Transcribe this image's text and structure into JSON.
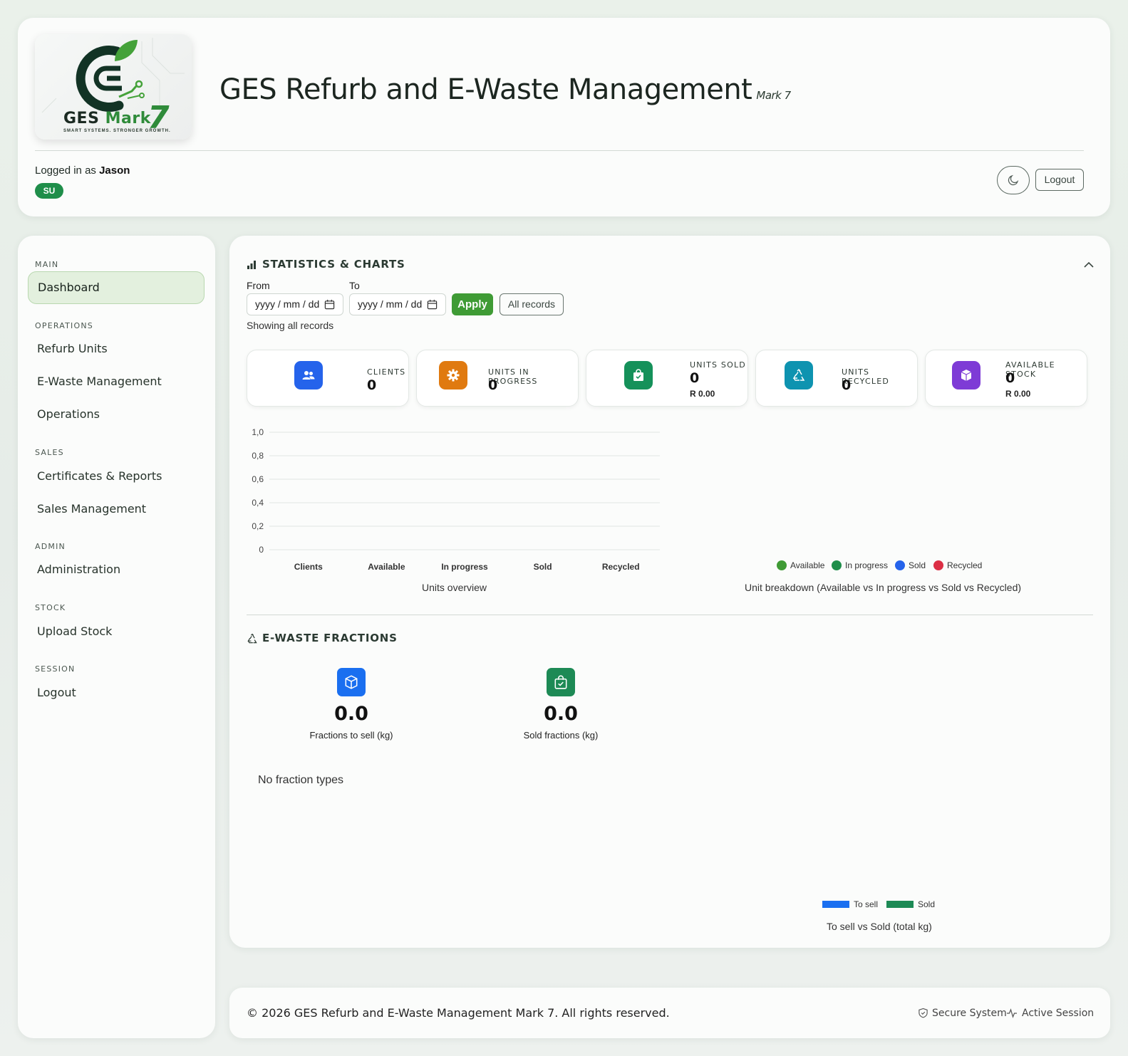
{
  "header": {
    "logo_brand_word": "GES",
    "logo_brand_word2": "Mark",
    "logo_brand_num": "7",
    "logo_tagline": "SMART SYSTEMS. STRONGER GROWTH.",
    "app_title": "GES Refurb and E-Waste Management",
    "app_version": "Mark 7",
    "logged_in_prefix": "Logged in as",
    "username": "Jason",
    "role_badge": "SU",
    "theme_toggle_icon": "moon-icon",
    "logout_label": "Logout"
  },
  "sidebar": {
    "sections": [
      {
        "label": "MAIN",
        "items": [
          {
            "label": "Dashboard",
            "active": true
          }
        ]
      },
      {
        "label": "OPERATIONS",
        "items": [
          {
            "label": "Refurb Units"
          },
          {
            "label": "E-Waste Management"
          },
          {
            "label": "Operations"
          }
        ]
      },
      {
        "label": "SALES",
        "items": [
          {
            "label": "Certificates & Reports"
          },
          {
            "label": "Sales Management"
          }
        ]
      },
      {
        "label": "ADMIN",
        "items": [
          {
            "label": "Administration"
          }
        ]
      },
      {
        "label": "STOCK",
        "items": [
          {
            "label": "Upload Stock"
          }
        ]
      },
      {
        "label": "SESSION",
        "items": [
          {
            "label": "Logout"
          }
        ]
      }
    ]
  },
  "stats": {
    "title": "STATISTICS & CHARTS",
    "from_label": "From",
    "to_label": "To",
    "from_placeholder": "yyyy / mm / dd",
    "to_placeholder": "yyyy / mm / dd",
    "apply_label": "Apply",
    "all_records_label": "All records",
    "showing_text": "Showing all records",
    "cards": [
      {
        "label": "CLIENTS",
        "value": "0",
        "color": "#2563eb",
        "icon": "users-icon"
      },
      {
        "label": "UNITS IN PROGRESS",
        "value": "0",
        "color": "#e07a10",
        "icon": "gear-icon"
      },
      {
        "label": "UNITS SOLD",
        "value": "0",
        "money": "R 0.00",
        "color": "#15915a",
        "icon": "shopping-bag-icon"
      },
      {
        "label": "UNITS RECYCLED",
        "value": "0",
        "color": "#0e93b0",
        "icon": "recycle-icon"
      },
      {
        "label": "AVAILABLE STOCK",
        "value": "0",
        "money": "R 0.00",
        "color": "#7e3bd6",
        "icon": "box-icon"
      }
    ],
    "units_overview_caption": "Units overview",
    "breakdown_caption": "Unit breakdown (Available vs In progress vs Sold vs Recycled)",
    "breakdown_legend": [
      {
        "label": "Available",
        "color": "#3f9b35"
      },
      {
        "label": "In progress",
        "color": "#1f8e4a"
      },
      {
        "label": "Sold",
        "color": "#2563eb"
      },
      {
        "label": "Recycled",
        "color": "#dc2f45"
      }
    ]
  },
  "chart_data": {
    "type": "bar",
    "categories": [
      "Clients",
      "Available",
      "In progress",
      "Sold",
      "Recycled"
    ],
    "values": [
      0,
      0,
      0,
      0,
      0
    ],
    "yticks": [
      "0",
      "0,2",
      "0,4",
      "0,6",
      "0,8",
      "1,0"
    ],
    "ylim": [
      0,
      1.0
    ],
    "xlabel": "Units overview"
  },
  "fractions": {
    "title": "E-WASTE FRACTIONS",
    "to_sell_value": "0.0",
    "to_sell_label": "Fractions to sell (kg)",
    "sold_value": "0.0",
    "sold_label": "Sold fractions (kg)",
    "no_types_text": "No fraction types",
    "legend": [
      {
        "label": "To sell",
        "color": "#1a6ff0"
      },
      {
        "label": "Sold",
        "color": "#1d8a55"
      }
    ],
    "chart_caption": "To sell vs Sold (total kg)"
  },
  "footer": {
    "copyright": "© 2026 GES Refurb and E-Waste Management Mark 7. All rights reserved.",
    "secure_label": "Secure System",
    "session_label": "Active Session"
  }
}
